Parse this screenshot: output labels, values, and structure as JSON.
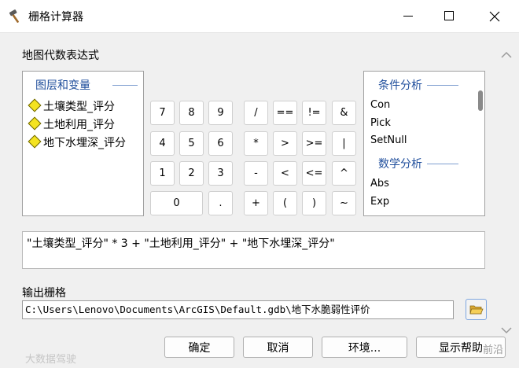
{
  "window": {
    "title": "栅格计算器"
  },
  "expression_section": {
    "label": "地图代数表达式"
  },
  "layers_panel": {
    "header": "图层和变量",
    "items": [
      "土壤类型_评分",
      "土地利用_评分",
      "地下水埋深_评分"
    ]
  },
  "keypad": {
    "keys": [
      "7",
      "8",
      "9",
      "/",
      "==",
      "!=",
      "&",
      "4",
      "5",
      "6",
      "*",
      ">",
      ">=",
      "|",
      "1",
      "2",
      "3",
      "-",
      "<",
      "<=",
      "^",
      "0",
      ".",
      "+",
      "(",
      ")",
      "~"
    ]
  },
  "tools_panel": {
    "groups": [
      {
        "header": "条件分析",
        "items": [
          "Con",
          "Pick",
          "SetNull"
        ]
      },
      {
        "header": "数学分析",
        "items": [
          "Abs",
          "Exp"
        ]
      }
    ]
  },
  "expression": {
    "text": "\"土壤类型_评分\" * 3 + \"土地利用_评分\" + \"地下水埋深_评分\""
  },
  "output": {
    "label": "输出栅格",
    "path": "C:\\Users\\Lenovo\\Documents\\ArcGIS\\Default.gdb\\地下水脆弱性评价"
  },
  "buttons": {
    "ok": "确定",
    "cancel": "取消",
    "env": "环境...",
    "help": "显示帮助"
  },
  "watermarks": {
    "left": "大数据驾驶",
    "right": "前沿"
  },
  "icons": {
    "app": "hammer-icon",
    "minimize": "minimize-icon",
    "maximize": "maximize-icon",
    "close": "close-icon",
    "folder": "folder-open-icon"
  },
  "colors": {
    "group_header": "#1f4e9c",
    "layer_diamond": "#f4e320"
  }
}
